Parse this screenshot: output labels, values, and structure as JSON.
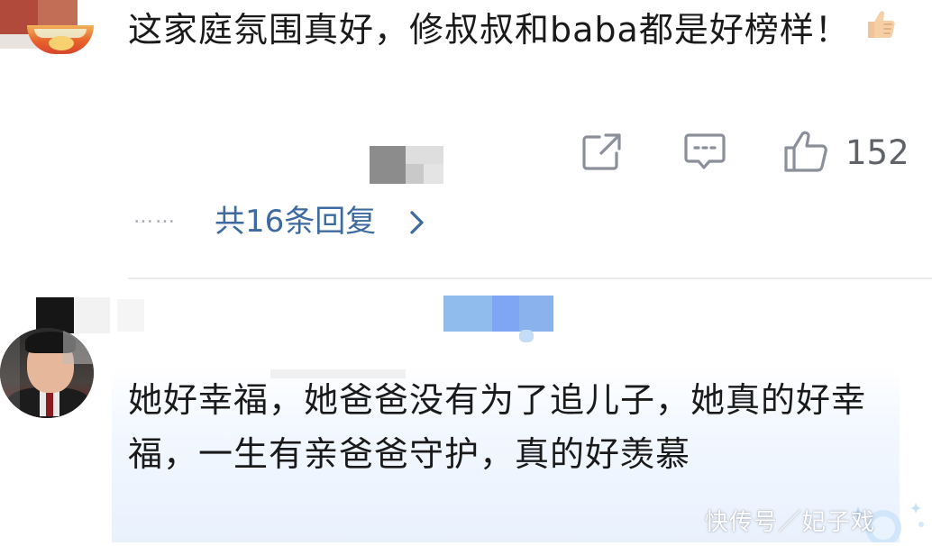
{
  "comment1": {
    "text": "这家庭氛围真好，修叔叔和baba都是好榜样！",
    "like_count": "152",
    "reply_dots": "……",
    "reply_summary": "共16条回复",
    "thumbs_emoji": "👍",
    "share_icon": "share-icon",
    "comment_icon": "comment-icon",
    "like_icon": "thumbs-up-icon"
  },
  "comment2": {
    "text": "她好幸福，她爸爸没有为了追儿子，她真的好幸福，一生有亲爸爸守护，真的好羡慕"
  },
  "watermark": {
    "text": "快传号／妃子戏"
  },
  "colors": {
    "reply_link": "#3d6aa1",
    "icon_gray": "#8a8f99",
    "bubble_bg": "#e9f1fd",
    "divider": "#ececec"
  }
}
